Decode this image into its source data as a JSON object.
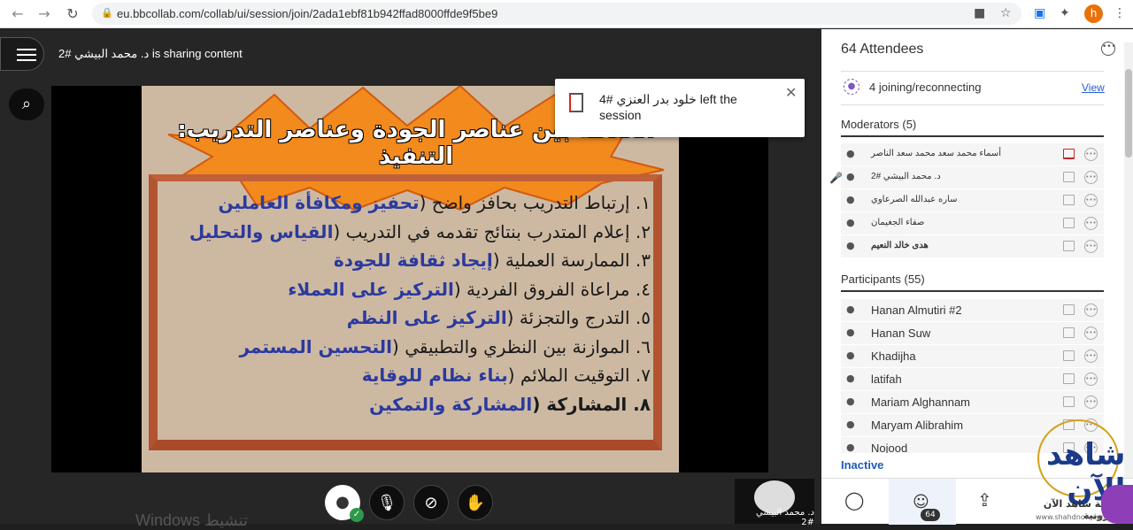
{
  "browser": {
    "url": "eu.bbcollab.com/collab/ui/session/join/2ada1ebf81b942ffad8000ffde9f5be9",
    "profile_initial": "h"
  },
  "session": {
    "sharing_text": "د. محمد البيشي #2 is sharing content"
  },
  "slide": {
    "title": "العلاقة بين عناصر الجودة وعناصر التدريب: التنفيذ",
    "items": [
      {
        "num": "١.",
        "text": "إرتباط التدريب بحافز واضح (",
        "highlight": "تحفيز ومكافأة العاملين"
      },
      {
        "num": "٢.",
        "text": "إعلام المتدرب بنتائج تقدمه في التدريب (",
        "highlight": "القياس والتحليل"
      },
      {
        "num": "٣.",
        "text": "الممارسة العملية (",
        "highlight": "إيجاد ثقافة للجودة"
      },
      {
        "num": "٤.",
        "text": "مراعاة الفروق الفردية (",
        "highlight": "التركيز على العملاء"
      },
      {
        "num": "٥.",
        "text": "التدرج والتجزئة (",
        "highlight": "التركيز على النظم"
      },
      {
        "num": "٦.",
        "text": "الموازنة بين النظري والتطبيقي (",
        "highlight": "التحسين المستمر"
      },
      {
        "num": "٧.",
        "text": "التوقيت الملائم (",
        "highlight": "بناء نظام للوقاية"
      },
      {
        "num": "٨.",
        "text": "المشاركة (",
        "highlight": "المشاركة والتمكين"
      }
    ]
  },
  "toast": {
    "message": "خلود بدر العنزي #4 left the session"
  },
  "stage": {
    "watermark": "Windows تنشيط",
    "speaker_name": "د. محمد البيشي #2"
  },
  "panel": {
    "title": "64 Attendees",
    "joining": "4 joining/reconnecting",
    "view": "View",
    "moderators_header": "Moderators (5)",
    "moderators": [
      "أسماء محمد سعد محمد سعد الناصر",
      "د. محمد البيشي #2",
      "ساره عبدالله الصرعاوي",
      "صفاء الجغيمان",
      "هدى خالد النعيم"
    ],
    "participants_header": "Participants (55)",
    "participants": [
      "Hanan Almutiri #2",
      "Hanan Suw",
      "Khadijha",
      "latifah",
      "Mariam Alghannam",
      "Maryam Alibrahim",
      "Nojood"
    ],
    "inactive": "Inactive",
    "attendee_count_badge": "64"
  },
  "logo": {
    "text": "مجموعة شاهد الآن الإلكترونية",
    "url": "www.shahdnow.com",
    "mark": "شاهد الآن"
  }
}
